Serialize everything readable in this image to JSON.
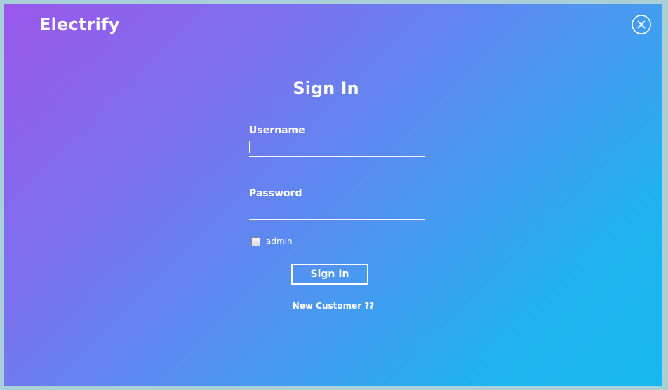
{
  "app": {
    "brand": "Electrify"
  },
  "form": {
    "title": "Sign In",
    "username_label": "Username",
    "username_value": "",
    "password_label": "Password",
    "password_value": "",
    "admin_label": "admin",
    "admin_checked": false,
    "submit_label": "Sign In",
    "new_customer_link": "New Customer ??"
  },
  "icons": {
    "close": "close-icon"
  },
  "colors": {
    "gradient_start": "#9a58ec",
    "gradient_end": "#17b8f0",
    "text": "#ffffff"
  }
}
